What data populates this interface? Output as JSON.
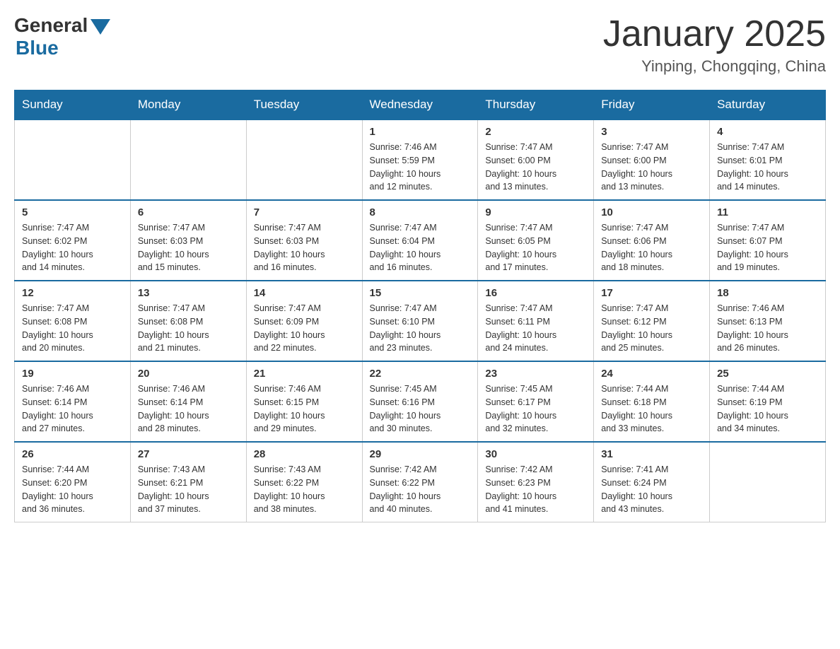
{
  "header": {
    "logo_general": "General",
    "logo_blue": "Blue",
    "month_title": "January 2025",
    "location": "Yinping, Chongqing, China"
  },
  "weekdays": [
    "Sunday",
    "Monday",
    "Tuesday",
    "Wednesday",
    "Thursday",
    "Friday",
    "Saturday"
  ],
  "weeks": [
    [
      {
        "day": "",
        "info": ""
      },
      {
        "day": "",
        "info": ""
      },
      {
        "day": "",
        "info": ""
      },
      {
        "day": "1",
        "info": "Sunrise: 7:46 AM\nSunset: 5:59 PM\nDaylight: 10 hours\nand 12 minutes."
      },
      {
        "day": "2",
        "info": "Sunrise: 7:47 AM\nSunset: 6:00 PM\nDaylight: 10 hours\nand 13 minutes."
      },
      {
        "day": "3",
        "info": "Sunrise: 7:47 AM\nSunset: 6:00 PM\nDaylight: 10 hours\nand 13 minutes."
      },
      {
        "day": "4",
        "info": "Sunrise: 7:47 AM\nSunset: 6:01 PM\nDaylight: 10 hours\nand 14 minutes."
      }
    ],
    [
      {
        "day": "5",
        "info": "Sunrise: 7:47 AM\nSunset: 6:02 PM\nDaylight: 10 hours\nand 14 minutes."
      },
      {
        "day": "6",
        "info": "Sunrise: 7:47 AM\nSunset: 6:03 PM\nDaylight: 10 hours\nand 15 minutes."
      },
      {
        "day": "7",
        "info": "Sunrise: 7:47 AM\nSunset: 6:03 PM\nDaylight: 10 hours\nand 16 minutes."
      },
      {
        "day": "8",
        "info": "Sunrise: 7:47 AM\nSunset: 6:04 PM\nDaylight: 10 hours\nand 16 minutes."
      },
      {
        "day": "9",
        "info": "Sunrise: 7:47 AM\nSunset: 6:05 PM\nDaylight: 10 hours\nand 17 minutes."
      },
      {
        "day": "10",
        "info": "Sunrise: 7:47 AM\nSunset: 6:06 PM\nDaylight: 10 hours\nand 18 minutes."
      },
      {
        "day": "11",
        "info": "Sunrise: 7:47 AM\nSunset: 6:07 PM\nDaylight: 10 hours\nand 19 minutes."
      }
    ],
    [
      {
        "day": "12",
        "info": "Sunrise: 7:47 AM\nSunset: 6:08 PM\nDaylight: 10 hours\nand 20 minutes."
      },
      {
        "day": "13",
        "info": "Sunrise: 7:47 AM\nSunset: 6:08 PM\nDaylight: 10 hours\nand 21 minutes."
      },
      {
        "day": "14",
        "info": "Sunrise: 7:47 AM\nSunset: 6:09 PM\nDaylight: 10 hours\nand 22 minutes."
      },
      {
        "day": "15",
        "info": "Sunrise: 7:47 AM\nSunset: 6:10 PM\nDaylight: 10 hours\nand 23 minutes."
      },
      {
        "day": "16",
        "info": "Sunrise: 7:47 AM\nSunset: 6:11 PM\nDaylight: 10 hours\nand 24 minutes."
      },
      {
        "day": "17",
        "info": "Sunrise: 7:47 AM\nSunset: 6:12 PM\nDaylight: 10 hours\nand 25 minutes."
      },
      {
        "day": "18",
        "info": "Sunrise: 7:46 AM\nSunset: 6:13 PM\nDaylight: 10 hours\nand 26 minutes."
      }
    ],
    [
      {
        "day": "19",
        "info": "Sunrise: 7:46 AM\nSunset: 6:14 PM\nDaylight: 10 hours\nand 27 minutes."
      },
      {
        "day": "20",
        "info": "Sunrise: 7:46 AM\nSunset: 6:14 PM\nDaylight: 10 hours\nand 28 minutes."
      },
      {
        "day": "21",
        "info": "Sunrise: 7:46 AM\nSunset: 6:15 PM\nDaylight: 10 hours\nand 29 minutes."
      },
      {
        "day": "22",
        "info": "Sunrise: 7:45 AM\nSunset: 6:16 PM\nDaylight: 10 hours\nand 30 minutes."
      },
      {
        "day": "23",
        "info": "Sunrise: 7:45 AM\nSunset: 6:17 PM\nDaylight: 10 hours\nand 32 minutes."
      },
      {
        "day": "24",
        "info": "Sunrise: 7:44 AM\nSunset: 6:18 PM\nDaylight: 10 hours\nand 33 minutes."
      },
      {
        "day": "25",
        "info": "Sunrise: 7:44 AM\nSunset: 6:19 PM\nDaylight: 10 hours\nand 34 minutes."
      }
    ],
    [
      {
        "day": "26",
        "info": "Sunrise: 7:44 AM\nSunset: 6:20 PM\nDaylight: 10 hours\nand 36 minutes."
      },
      {
        "day": "27",
        "info": "Sunrise: 7:43 AM\nSunset: 6:21 PM\nDaylight: 10 hours\nand 37 minutes."
      },
      {
        "day": "28",
        "info": "Sunrise: 7:43 AM\nSunset: 6:22 PM\nDaylight: 10 hours\nand 38 minutes."
      },
      {
        "day": "29",
        "info": "Sunrise: 7:42 AM\nSunset: 6:22 PM\nDaylight: 10 hours\nand 40 minutes."
      },
      {
        "day": "30",
        "info": "Sunrise: 7:42 AM\nSunset: 6:23 PM\nDaylight: 10 hours\nand 41 minutes."
      },
      {
        "day": "31",
        "info": "Sunrise: 7:41 AM\nSunset: 6:24 PM\nDaylight: 10 hours\nand 43 minutes."
      },
      {
        "day": "",
        "info": ""
      }
    ]
  ]
}
